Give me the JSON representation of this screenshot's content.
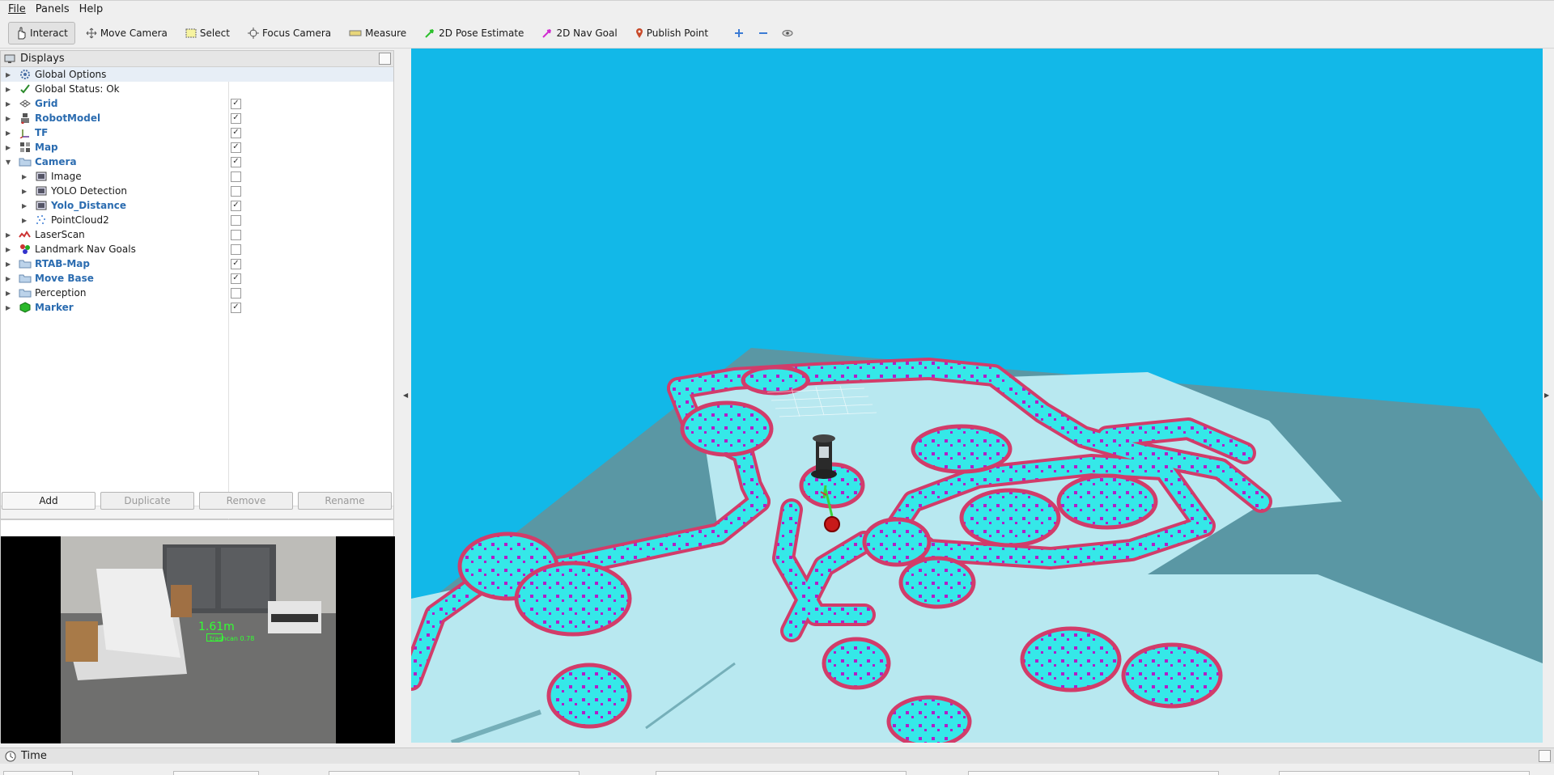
{
  "menu": {
    "items": [
      "File",
      "Panels",
      "Help"
    ]
  },
  "toolbar": {
    "tools": [
      "Interact",
      "Move Camera",
      "Select",
      "Focus Camera",
      "Measure",
      "2D Pose Estimate",
      "2D Nav Goal",
      "Publish Point"
    ],
    "active": "Interact"
  },
  "displays": {
    "title": "Displays",
    "items": [
      {
        "label": "Global Options",
        "bold": false,
        "checked": null,
        "icon": "gear-icon",
        "indent": 0
      },
      {
        "label": "Global Status: Ok",
        "bold": false,
        "checked": null,
        "icon": "checkmark-icon",
        "indent": 0
      },
      {
        "label": "Grid",
        "bold": true,
        "checked": true,
        "icon": "grid-icon",
        "indent": 0
      },
      {
        "label": "RobotModel",
        "bold": true,
        "checked": true,
        "icon": "robot-icon",
        "indent": 0
      },
      {
        "label": "TF",
        "bold": true,
        "checked": true,
        "icon": "axes-icon",
        "indent": 0
      },
      {
        "label": "Map",
        "bold": true,
        "checked": true,
        "icon": "map-icon",
        "indent": 0
      },
      {
        "label": "Camera",
        "bold": true,
        "checked": true,
        "icon": "folder-icon",
        "indent": 0,
        "expanded": true
      },
      {
        "label": "Image",
        "bold": false,
        "checked": false,
        "icon": "image-icon",
        "indent": 1
      },
      {
        "label": "YOLO Detection",
        "bold": false,
        "checked": false,
        "icon": "image-icon",
        "indent": 1
      },
      {
        "label": "Yolo_Distance",
        "bold": true,
        "checked": true,
        "icon": "image-icon",
        "indent": 1
      },
      {
        "label": "PointCloud2",
        "bold": false,
        "checked": false,
        "icon": "pointcloud-icon",
        "indent": 1
      },
      {
        "label": "LaserScan",
        "bold": false,
        "checked": false,
        "icon": "laserscan-icon",
        "indent": 0
      },
      {
        "label": "Landmark Nav Goals",
        "bold": false,
        "checked": false,
        "icon": "landmark-icon",
        "indent": 0
      },
      {
        "label": "RTAB-Map",
        "bold": true,
        "checked": true,
        "icon": "folder-icon",
        "indent": 0
      },
      {
        "label": "Move Base",
        "bold": true,
        "checked": true,
        "icon": "folder-icon",
        "indent": 0
      },
      {
        "label": "Perception",
        "bold": false,
        "checked": false,
        "icon": "folder-icon",
        "indent": 0
      },
      {
        "label": "Marker",
        "bold": true,
        "checked": true,
        "icon": "marker-cube-icon",
        "indent": 0
      }
    ]
  },
  "buttons": {
    "add": "Add",
    "duplicate": "Duplicate",
    "remove": "Remove",
    "rename": "Rename"
  },
  "camera_overlay": {
    "distance": "1.61m",
    "detection": "trashcan 0.78"
  },
  "time_panel": {
    "title": "Time"
  },
  "colors": {
    "viewport_bg": "#12b8e8",
    "floor": "#5a97a4",
    "free": "#b8e8f0",
    "inflation": "#35e8e8",
    "lethal": "#d23c6a",
    "obstacle": "#b020c8"
  }
}
